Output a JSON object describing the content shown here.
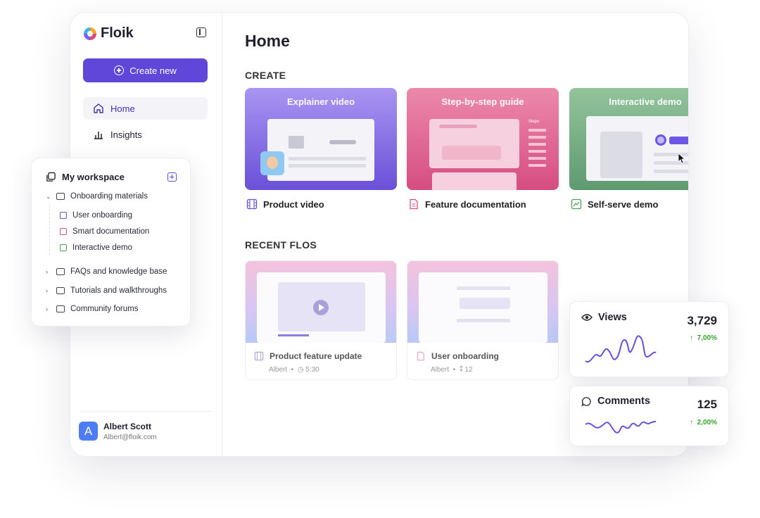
{
  "app": {
    "name": "Floik",
    "create_label": "Create new",
    "nav": [
      {
        "label": "Home",
        "active": true,
        "icon": "home-icon"
      },
      {
        "label": "Insights",
        "active": false,
        "icon": "bar-chart-icon"
      }
    ],
    "user": {
      "initial": "A",
      "name": "Albert Scott",
      "email": "Albert@floik.com"
    }
  },
  "main": {
    "title": "Home",
    "create_section": "CREATE",
    "create_cards": [
      {
        "label": "Explainer video",
        "subtitle": "Product video",
        "icon": "film-icon",
        "color": "#6b50d8"
      },
      {
        "label": "Step-by-step guide",
        "subtitle": "Feature documentation",
        "icon": "document-icon",
        "color": "#d64d82",
        "thumb_text": "Steps"
      },
      {
        "label": "Interactive demo",
        "subtitle": "Self-serve demo",
        "icon": "interactive-icon",
        "color": "#5e9a70"
      }
    ],
    "recent_section": "RECENT FLOS",
    "recent": [
      {
        "title": "Product feature update",
        "author": "Albert",
        "duration": "5:30",
        "icon": "film-icon"
      },
      {
        "title": "User onboarding",
        "author": "Albert",
        "count": "12",
        "icon": "document-icon"
      }
    ]
  },
  "workspace": {
    "title": "My workspace",
    "folders": [
      {
        "label": "Onboarding materials",
        "expanded": true,
        "children": [
          {
            "label": "User onboarding",
            "icon": "film-icon"
          },
          {
            "label": "Smart documentation",
            "icon": "document-icon"
          },
          {
            "label": "Interactive demo",
            "icon": "interactive-icon"
          }
        ]
      },
      {
        "label": "FAQs and knowledge base",
        "expanded": false
      },
      {
        "label": "Tutorials and walkthroughs",
        "expanded": false
      },
      {
        "label": "Community forums",
        "expanded": false
      }
    ]
  },
  "stats": [
    {
      "label": "Views",
      "value": "3,729",
      "change": "7,00%",
      "icon": "eye-icon"
    },
    {
      "label": "Comments",
      "value": "125",
      "change": "2,00%",
      "icon": "comment-icon"
    }
  ],
  "colors": {
    "accent": "#6047d9",
    "positive": "#38a32a"
  }
}
